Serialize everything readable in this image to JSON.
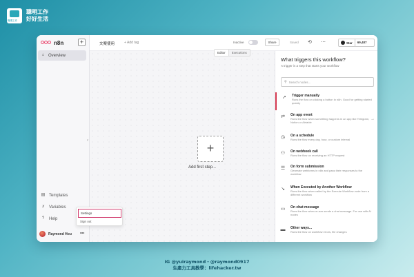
{
  "brand": {
    "logo_text": "職場工作",
    "line1": "聰明工作",
    "line2": "好好生活"
  },
  "sidebar": {
    "logo": "n8n",
    "plus": "+",
    "overview": "Overview",
    "items": [
      {
        "label": "Templates",
        "icon": "templates-icon"
      },
      {
        "label": "Variables",
        "icon": "variables-icon"
      },
      {
        "label": "Help",
        "icon": "help-icon"
      }
    ],
    "user": "Raymond Hou",
    "more": "•••"
  },
  "user_menu": {
    "settings": "Settings",
    "sign_out": "Sign out"
  },
  "topbar": {
    "workflow_name": "文案使用",
    "add_tag": "+ Add tag",
    "status": "Inactive",
    "share": "Share",
    "saved": "Saved",
    "star_label": "Star",
    "star_count": "69,487"
  },
  "tabs": {
    "editor": "Editor",
    "executions": "Executions"
  },
  "canvas": {
    "add_symbol": "+",
    "add_label": "Add first step..."
  },
  "panel": {
    "title": "What triggers this workflow?",
    "subtitle": "A trigger is a step that starts your workflow",
    "search_placeholder": "Search nodes...",
    "nodes": [
      {
        "name": "Trigger manually",
        "desc": "Runs the flow on clicking a button in n8n. Good for getting started quickly",
        "icon": "cursor-icon"
      },
      {
        "name": "On app event",
        "desc": "Runs the flow when something happens in an app like Telegram, Notion or Airtable",
        "icon": "app-event-icon"
      },
      {
        "name": "On a schedule",
        "desc": "Runs the flow every day, hour, or custom interval",
        "icon": "clock-icon"
      },
      {
        "name": "On webhook call",
        "desc": "Runs the flow on receiving an HTTP request",
        "icon": "webhook-icon"
      },
      {
        "name": "On form submission",
        "desc": "Generate webforms in n8n and pass their responses to the workflow",
        "icon": "form-icon"
      },
      {
        "name": "When Executed by Another Workflow",
        "desc": "Runs the flow when called by the Execute Workflow node from a different workflow",
        "icon": "workflow-icon"
      },
      {
        "name": "On chat message",
        "desc": "Runs the flow when a user sends a chat message. For use with AI nodes",
        "icon": "chat-icon"
      },
      {
        "name": "Other ways...",
        "desc": "Runs the flow on workflow errors, file changes",
        "icon": "other-icon"
      }
    ]
  },
  "caption": {
    "line1": "IG @yuiraymond・@raymond0917",
    "line2": "生產力工具教學：lifehacker.tw"
  },
  "colors": {
    "accent": "#ea4b71",
    "selected_border": "#d0386b",
    "background": "#4fb3c4"
  }
}
